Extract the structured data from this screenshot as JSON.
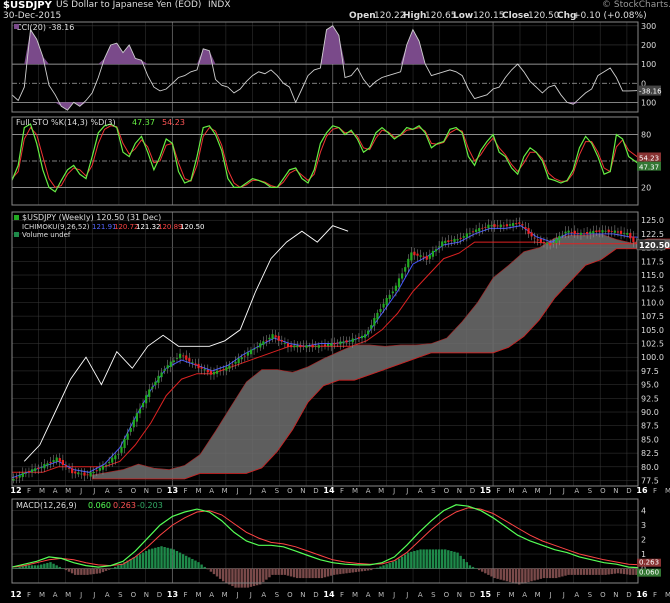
{
  "header": {
    "symbol": "$USDJPY",
    "description": "US Dollar to Japanese Yen (EOD)",
    "exchange": "INDX",
    "date": "30-Dec-2015",
    "watermark": "© StockCharts.com",
    "open_label": "Open",
    "open": "120.22",
    "high_label": "High",
    "high": "120.65",
    "low_label": "Low",
    "low": "120.15",
    "close_label": "Close",
    "close": "120.50",
    "chg_label": "Chg",
    "chg": "+0.10 (+0.08%)"
  },
  "colors": {
    "background": "#000000",
    "grid": "#3a3a3a",
    "text": "#dddddd",
    "price_line": "#ffffff",
    "up_candle": "#22aa22",
    "down_candle": "#ee2222",
    "cloud": "#777777",
    "tenkan": "#4455ff",
    "kijun": "#dd2222",
    "cci_fill": "#7a4a8a",
    "sto_k": "#66ee44",
    "macd_line": "#55ff55",
    "signal_line": "#ff4444",
    "histogram": "#1e8a4a"
  },
  "chart_data": [
    {
      "type": "area",
      "title": "CCI(20)",
      "legend_text": "CCI(20) -38.16",
      "value": -38.16,
      "ylim": [
        -150,
        320
      ],
      "yticks": [
        "300",
        "200",
        "100",
        "0",
        "100"
      ],
      "last_label": "-38.16",
      "x": [
        0,
        2,
        4,
        6,
        8,
        10,
        12,
        14,
        16,
        18,
        20,
        22,
        24,
        26,
        28,
        30,
        32,
        34,
        36,
        38,
        40,
        42,
        44,
        46,
        48,
        50,
        52,
        54,
        56,
        58,
        60,
        62,
        64,
        66,
        68,
        70,
        72,
        74,
        76,
        78,
        80,
        82,
        84,
        86,
        88,
        90,
        92,
        94,
        96,
        98,
        100,
        102,
        104,
        106,
        108,
        110,
        112,
        114,
        116,
        118,
        120,
        122,
        124,
        126,
        128,
        130,
        132,
        134,
        136,
        138,
        140,
        142,
        144,
        146,
        148,
        150,
        152,
        154,
        156,
        158,
        160,
        162,
        164,
        166,
        168,
        170,
        172,
        174,
        176,
        178,
        180,
        182,
        184,
        186,
        188,
        190,
        192,
        194,
        196,
        198,
        200,
        203
      ],
      "values": [
        -60,
        -90,
        -20,
        280,
        230,
        140,
        -10,
        -60,
        -120,
        -140,
        -100,
        -120,
        -90,
        -50,
        30,
        130,
        200,
        210,
        160,
        200,
        130,
        120,
        40,
        -20,
        -40,
        -30,
        0,
        30,
        40,
        60,
        70,
        180,
        170,
        20,
        -10,
        -20,
        -50,
        -30,
        10,
        40,
        60,
        50,
        70,
        40,
        0,
        -20,
        -100,
        -30,
        40,
        70,
        80,
        280,
        300,
        250,
        30,
        40,
        80,
        20,
        -20,
        10,
        30,
        40,
        50,
        60,
        200,
        280,
        220,
        100,
        40,
        50,
        60,
        70,
        60,
        40,
        -30,
        -80,
        -70,
        -60,
        -30,
        -20,
        30,
        70,
        100,
        60,
        10,
        -20,
        -50,
        -20,
        -10,
        -60,
        -100,
        -110,
        -80,
        -50,
        -30,
        40,
        60,
        80,
        30,
        -40,
        -40,
        -38.16
      ]
    },
    {
      "type": "line",
      "title": "Full STO %K(14,3) %D(3)",
      "legend_prefix": "Full STO %K(14,3) %D(3)",
      "k_last": "47.37",
      "d_last": "54.23",
      "ylim": [
        0,
        100
      ],
      "yticks": [
        "80",
        "50",
        "20"
      ],
      "x": [
        0,
        2,
        4,
        6,
        8,
        10,
        12,
        14,
        16,
        18,
        20,
        22,
        24,
        26,
        28,
        30,
        32,
        34,
        36,
        38,
        40,
        42,
        44,
        46,
        48,
        50,
        52,
        54,
        56,
        58,
        60,
        62,
        64,
        66,
        68,
        70,
        72,
        74,
        76,
        78,
        80,
        82,
        84,
        86,
        88,
        90,
        92,
        94,
        96,
        98,
        100,
        102,
        104,
        106,
        108,
        110,
        112,
        114,
        116,
        118,
        120,
        122,
        124,
        126,
        128,
        130,
        132,
        134,
        136,
        138,
        140,
        142,
        144,
        146,
        148,
        150,
        152,
        154,
        156,
        158,
        160,
        162,
        164,
        166,
        168,
        170,
        172,
        174,
        176,
        178,
        180,
        182,
        184,
        186,
        188,
        190,
        192,
        194,
        196,
        198,
        200,
        203
      ],
      "k_values": [
        28,
        45,
        88,
        92,
        70,
        40,
        20,
        15,
        28,
        40,
        45,
        35,
        30,
        55,
        82,
        90,
        92,
        88,
        60,
        55,
        70,
        78,
        60,
        40,
        55,
        75,
        70,
        38,
        25,
        28,
        55,
        88,
        90,
        80,
        62,
        30,
        20,
        20,
        25,
        30,
        28,
        25,
        20,
        20,
        30,
        40,
        42,
        30,
        25,
        40,
        70,
        82,
        90,
        88,
        80,
        85,
        75,
        60,
        65,
        82,
        88,
        82,
        75,
        80,
        88,
        86,
        90,
        82,
        65,
        70,
        72,
        86,
        88,
        82,
        55,
        45,
        62,
        72,
        80,
        60,
        55,
        42,
        35,
        55,
        65,
        60,
        50,
        30,
        28,
        25,
        28,
        40,
        65,
        78,
        70,
        55,
        35,
        38,
        80,
        75,
        55,
        47.37
      ],
      "d_values": [
        30,
        38,
        75,
        88,
        80,
        55,
        30,
        20,
        22,
        35,
        42,
        40,
        33,
        45,
        70,
        86,
        90,
        89,
        70,
        58,
        64,
        74,
        66,
        48,
        50,
        68,
        70,
        48,
        30,
        27,
        45,
        78,
        88,
        84,
        68,
        40,
        25,
        20,
        23,
        28,
        28,
        26,
        22,
        20,
        26,
        36,
        40,
        34,
        28,
        35,
        60,
        78,
        86,
        88,
        82,
        83,
        78,
        65,
        63,
        76,
        85,
        83,
        77,
        79,
        85,
        86,
        88,
        84,
        70,
        69,
        71,
        82,
        86,
        84,
        64,
        50,
        57,
        68,
        76,
        65,
        57,
        46,
        38,
        48,
        60,
        60,
        53,
        36,
        30,
        27,
        27,
        36,
        57,
        72,
        72,
        60,
        42,
        38,
        66,
        74,
        62,
        54.23
      ]
    },
    {
      "type": "line",
      "title": "$USDJPY (Weekly) 120.50 (31 Dec)",
      "legend_text": "$USDJPY (Weekly) 120.50 (31 Dec)",
      "ichimoku_label": "ICHIMOKU(9,26,52)",
      "ichimoku_values": [
        "121.91",
        "120.72",
        "121.32",
        "120.89",
        "120.50"
      ],
      "volume_label": "Volume undef",
      "last_label": "120.50",
      "ylim": [
        76.5,
        126.5
      ],
      "yticks": [
        125,
        122.5,
        120,
        117.5,
        115,
        112.5,
        110,
        107.5,
        105,
        102.5,
        100,
        97.5,
        95,
        92.5,
        90,
        87.5,
        85,
        82.5,
        80,
        77.5
      ],
      "x": [
        0,
        5,
        10,
        15,
        20,
        25,
        30,
        35,
        40,
        45,
        50,
        55,
        60,
        65,
        70,
        75,
        80,
        85,
        90,
        95,
        100,
        105,
        110,
        115,
        120,
        125,
        130,
        135,
        140,
        145,
        150,
        155,
        160,
        165,
        170,
        175,
        180,
        185,
        190,
        195,
        200,
        203
      ],
      "price": [
        77.5,
        79,
        80,
        81.5,
        79,
        78.5,
        80,
        82.5,
        88.5,
        94,
        98,
        100.5,
        98.5,
        97,
        98,
        100,
        102,
        104,
        102,
        102,
        102,
        102.5,
        103,
        104,
        109,
        113,
        119,
        118,
        121,
        121.5,
        123,
        124,
        124,
        124.5,
        121.5,
        120.5,
        123,
        122.5,
        123,
        123,
        122.5,
        120.5
      ],
      "tenkan": [
        78,
        79,
        80,
        81,
        79.5,
        79,
        80.5,
        83.5,
        89,
        94,
        98,
        99.5,
        98.5,
        97.5,
        98.5,
        100.5,
        102,
        103.5,
        102.5,
        102,
        102.5,
        102.5,
        103,
        104,
        108,
        112,
        117,
        118.5,
        120.5,
        121,
        122.5,
        123.5,
        123.5,
        124,
        122,
        121,
        122.5,
        122.5,
        122.5,
        122.5,
        122,
        121.9
      ],
      "kijun": [
        79,
        79,
        79,
        80,
        80,
        80,
        80,
        81,
        84,
        88,
        93,
        96,
        97,
        97,
        98,
        99,
        100,
        101,
        102,
        102,
        102,
        102,
        102,
        103,
        105,
        108,
        112,
        115,
        118,
        119,
        121,
        121,
        121,
        121,
        121,
        120.7,
        120.7,
        120.7,
        120.7,
        120.7,
        120.7,
        120.7
      ],
      "chikou": [
        81,
        84,
        90,
        96,
        100,
        95,
        101,
        98,
        102,
        104,
        102,
        102,
        102,
        103,
        105,
        112,
        118,
        121,
        123,
        121,
        124,
        123
      ]
    },
    {
      "type": "line",
      "title": "MACD(12,26,9)",
      "legend_prefix": "MACD(12,26,9)",
      "macd_last": "0.060",
      "signal_last": "0.263",
      "hist_last": "-0.203",
      "ylim": [
        -1.0,
        4.8
      ],
      "yticks": [
        "4",
        "3",
        "2",
        "1",
        "0"
      ],
      "x": [
        0,
        4,
        8,
        12,
        16,
        20,
        24,
        28,
        32,
        36,
        40,
        44,
        48,
        52,
        56,
        60,
        64,
        68,
        72,
        76,
        80,
        84,
        88,
        92,
        96,
        100,
        104,
        108,
        112,
        116,
        120,
        124,
        128,
        132,
        136,
        140,
        144,
        148,
        152,
        156,
        160,
        164,
        168,
        172,
        176,
        180,
        184,
        188,
        192,
        196,
        200,
        203
      ],
      "macd": [
        0.1,
        0.3,
        0.5,
        0.8,
        0.7,
        0.4,
        0.2,
        0.1,
        0.2,
        0.5,
        1.2,
        2.1,
        3.0,
        3.6,
        3.9,
        4.1,
        3.9,
        3.3,
        2.5,
        1.9,
        1.6,
        1.6,
        1.5,
        1.2,
        0.9,
        0.6,
        0.4,
        0.3,
        0.25,
        0.25,
        0.4,
        0.8,
        1.6,
        2.5,
        3.3,
        4.0,
        4.4,
        4.3,
        4.0,
        3.5,
        2.9,
        2.3,
        1.9,
        1.6,
        1.3,
        1.1,
        0.8,
        0.6,
        0.4,
        0.3,
        0.1,
        0.06
      ],
      "signal": [
        0.1,
        0.2,
        0.4,
        0.6,
        0.7,
        0.6,
        0.4,
        0.25,
        0.2,
        0.3,
        0.8,
        1.5,
        2.3,
        3.0,
        3.5,
        3.9,
        4.0,
        3.7,
        3.1,
        2.5,
        2.1,
        1.8,
        1.7,
        1.5,
        1.2,
        0.9,
        0.6,
        0.45,
        0.35,
        0.3,
        0.32,
        0.55,
        1.1,
        1.9,
        2.7,
        3.4,
        3.9,
        4.2,
        4.1,
        3.8,
        3.3,
        2.8,
        2.3,
        1.9,
        1.6,
        1.3,
        1.0,
        0.8,
        0.6,
        0.45,
        0.3,
        0.263
      ],
      "histogram": [
        0.0,
        0.1,
        0.1,
        0.2,
        0.0,
        -0.2,
        -0.2,
        -0.15,
        0.0,
        0.2,
        0.4,
        0.6,
        0.7,
        0.6,
        0.4,
        0.2,
        -0.1,
        -0.4,
        -0.6,
        -0.6,
        -0.5,
        -0.2,
        -0.2,
        -0.3,
        -0.3,
        -0.3,
        -0.2,
        -0.15,
        -0.1,
        -0.05,
        0.1,
        0.25,
        0.5,
        0.6,
        0.6,
        0.6,
        0.5,
        0.1,
        -0.1,
        -0.3,
        -0.4,
        -0.5,
        -0.4,
        -0.3,
        -0.3,
        -0.2,
        -0.2,
        -0.2,
        -0.2,
        -0.15,
        -0.2,
        -0.203
      ]
    }
  ],
  "x_axis": {
    "month_labels": [
      "12",
      "F",
      "M",
      "A",
      "M",
      "J",
      "J",
      "A",
      "S",
      "O",
      "N",
      "D",
      "13",
      "F",
      "M",
      "A",
      "M",
      "J",
      "J",
      "A",
      "S",
      "O",
      "N",
      "D",
      "14",
      "F",
      "M",
      "A",
      "M",
      "J",
      "J",
      "A",
      "S",
      "O",
      "N",
      "D",
      "15",
      "F",
      "M",
      "A",
      "M",
      "J",
      "J",
      "A",
      "S",
      "O",
      "N",
      "D",
      "16",
      "F",
      "M",
      "A",
      "M",
      "J"
    ],
    "year_labels": [
      "12",
      "13",
      "14",
      "15",
      "16"
    ]
  }
}
